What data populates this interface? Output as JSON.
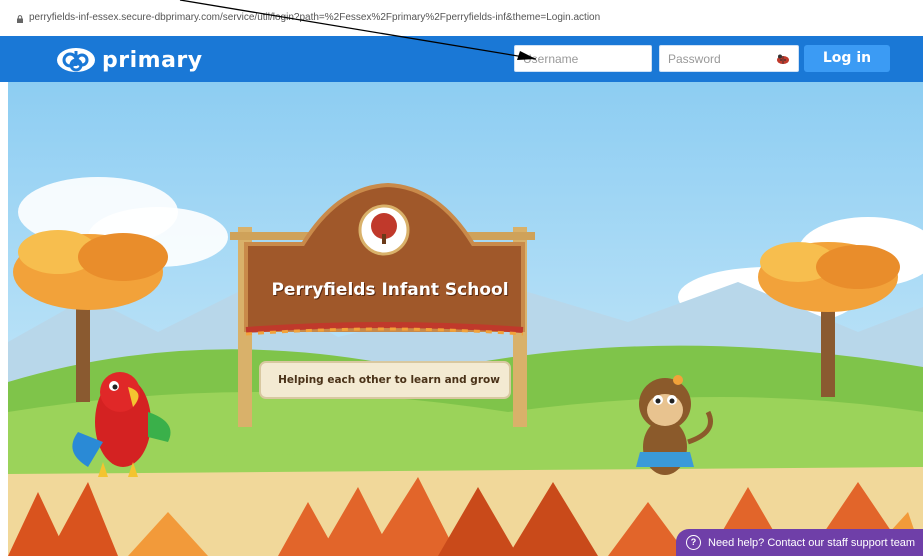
{
  "browser": {
    "url": "perryfields-inf-essex.secure-dbprimary.com/service/util/login?path=%2Fessex%2Fprimary%2Fperryfields-inf&theme=Login.action",
    "lock_icon": "lock-icon"
  },
  "header": {
    "logo_text": "primary",
    "logo_mark": "db-logo",
    "username_placeholder": "Username",
    "password_placeholder": "Password",
    "eye_icon": "ladybird-show-password-icon",
    "login_label": "Log in",
    "colors": {
      "bar": "#1a78d6",
      "button": "#3b9bf4"
    }
  },
  "sign": {
    "title": "Perryfields Infant School",
    "subtitle": "Helping each other to learn and grow"
  },
  "help": {
    "icon": "question-icon",
    "text": "Need help? Contact our staff support team"
  }
}
